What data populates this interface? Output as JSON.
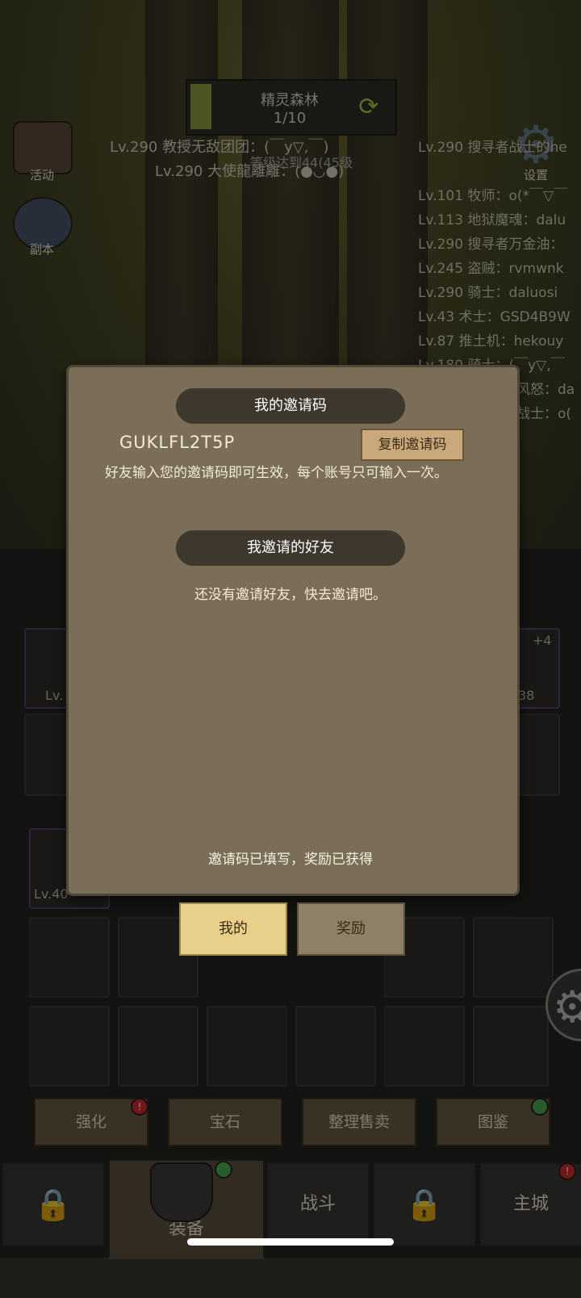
{
  "stage": {
    "name": "精灵森林",
    "progress": "1/10"
  },
  "side_left": [
    {
      "label": "活动",
      "icon": "activity-icon"
    },
    {
      "label": "副本",
      "icon": "dungeon-icon"
    }
  ],
  "settings_label": "设置",
  "notices": [
    "Lv.290 教授无敌团团：(￣y▽,￣)",
    "Lv.290 大使龍離離：(●◡●)",
    "等级达到44(45级"
  ],
  "chat": [
    "Lv.290 搜寻者战士的he",
    "Lv.101 牧师：o(*￣▽￣",
    "Lv.113 地狱魔魂：dalu",
    "Lv.290 搜寻者万金油：",
    "Lv.245 盗贼：rvmwnk",
    "Lv.290 骑士：daluosi",
    "Lv.43 术士：GSD4B9W",
    "Lv.87 推土机：hekouy",
    "Lv.180 骑士：(￣y▽,￣",
    "风怒：da",
    "战士：o("
  ],
  "equip_labels": {
    "left": "Lv.",
    "right_plus": "+4",
    "right_num": "38",
    "bag_lv": "Lv.40"
  },
  "modal": {
    "code_title": "我的邀请码",
    "code": "GUKLFL2T5P",
    "copy_label": "复制邀请码",
    "description": "好友输入您的邀请码即可生效，每个账号只可输入一次。",
    "friends_title": "我邀请的好友",
    "friends_empty": "还没有邀请好友，快去邀请吧。",
    "status": "邀请码已填写，奖励已获得"
  },
  "modal_tabs": {
    "mine": "我的",
    "reward": "奖励"
  },
  "actions": [
    "强化",
    "宝石",
    "整理售卖",
    "图鉴"
  ],
  "nav": {
    "equip": "装备",
    "battle": "战斗",
    "city": "主城"
  },
  "colors": {
    "modal_bg": "#7b6e58",
    "pill_bg": "#3d372d",
    "tab_active": "#e8cf8a",
    "badge_red": "#d02a2a",
    "badge_green": "#4aa84a"
  }
}
